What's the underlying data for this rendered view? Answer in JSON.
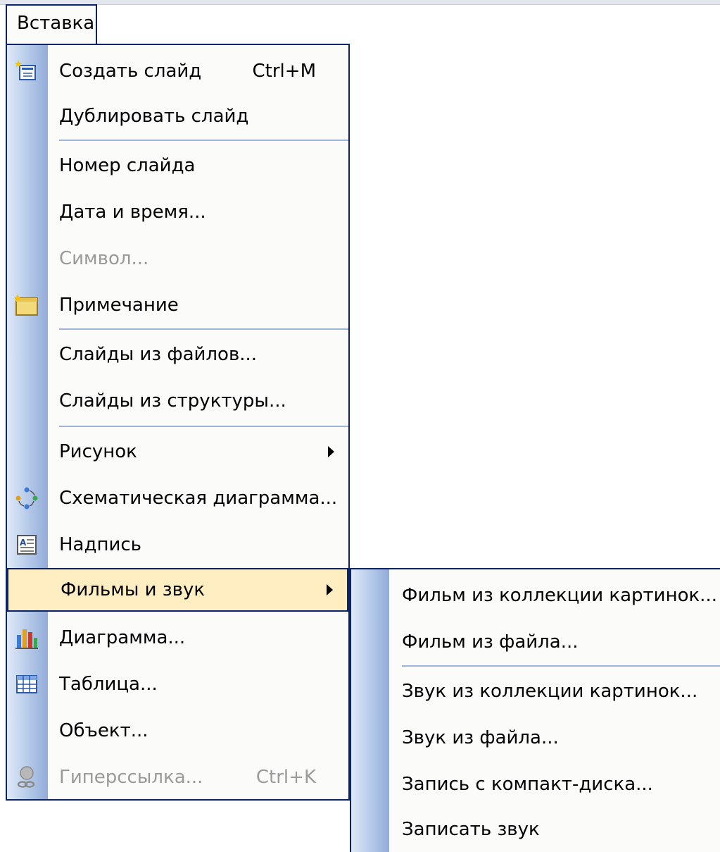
{
  "menu_title": "Вставка",
  "menu_items": [
    {
      "label": "Создать слайд",
      "shortcut": "Ctrl+M",
      "icon": "new-slide-icon"
    },
    {
      "label": "Дублировать слайд"
    },
    {
      "label": "Номер слайда"
    },
    {
      "label": "Дата и время..."
    },
    {
      "label": "Символ...",
      "disabled": true
    },
    {
      "label": "Примечание",
      "icon": "comment-icon"
    },
    {
      "label": "Слайды из файлов..."
    },
    {
      "label": "Слайды из структуры..."
    },
    {
      "label": "Рисунок",
      "has_submenu": true
    },
    {
      "label": "Схематическая диаграмма...",
      "icon": "diagram-icon"
    },
    {
      "label": "Надпись",
      "icon": "textbox-icon"
    },
    {
      "label": "Фильмы и звук",
      "has_submenu": true,
      "highlighted": true
    },
    {
      "label": "Диаграмма...",
      "icon": "chart-icon"
    },
    {
      "label": "Таблица...",
      "icon": "table-icon"
    },
    {
      "label": "Объект..."
    },
    {
      "label": "Гиперссылка...",
      "shortcut": "Ctrl+K",
      "disabled": true,
      "icon": "hyperlink-icon"
    }
  ],
  "submenu_items": [
    {
      "label": "Фильм из коллекции картинок..."
    },
    {
      "label": "Фильм из файла..."
    },
    {
      "label": "Звук из коллекции картинок..."
    },
    {
      "label": "Звук из файла..."
    },
    {
      "label": "Запись с компакт-диска..."
    },
    {
      "label": "Записать звук"
    }
  ],
  "colors": {
    "menu_border": "#0a246a",
    "highlight": "#ffeec2",
    "gutter": "#b3c8e8",
    "disabled_text": "#9a9a9a"
  }
}
